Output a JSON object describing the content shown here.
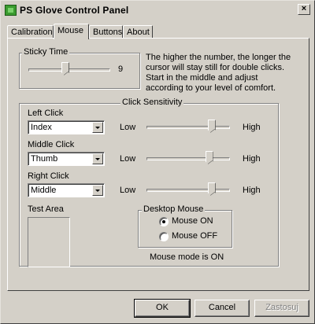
{
  "window": {
    "title": "PS Glove Control Panel",
    "close_glyph": "×",
    "icon": "glove-app-icon"
  },
  "tabs": [
    {
      "label": "Calibration",
      "active": false
    },
    {
      "label": "Mouse",
      "active": true
    },
    {
      "label": "Buttons",
      "active": false
    },
    {
      "label": "About",
      "active": false
    }
  ],
  "sticky_time": {
    "label": "Sticky Time",
    "value": "9",
    "slider_fraction": 0.45,
    "description_lines": [
      "The higher the number, the longer the",
      "cursor will stay still for double clicks.",
      "Start in the middle and adjust",
      "according to your level of comfort."
    ]
  },
  "click_sensitivity": {
    "label": "Click Sensitivity",
    "low_label": "Low",
    "high_label": "High",
    "rows": [
      {
        "label": "Left Click",
        "selected": "Index",
        "slider_fraction": 0.78
      },
      {
        "label": "Middle Click",
        "selected": "Thumb",
        "slider_fraction": 0.75
      },
      {
        "label": "Right Click",
        "selected": "Middle",
        "slider_fraction": 0.78
      }
    ]
  },
  "test_area": {
    "label": "Test Area"
  },
  "desktop_mouse": {
    "label": "Desktop Mouse",
    "options": [
      {
        "label": "Mouse ON",
        "checked": true
      },
      {
        "label": "Mouse OFF",
        "checked": false
      }
    ],
    "status": "Mouse mode is ON"
  },
  "footer": {
    "ok": "OK",
    "cancel": "Cancel",
    "apply": "Zastosuj"
  }
}
